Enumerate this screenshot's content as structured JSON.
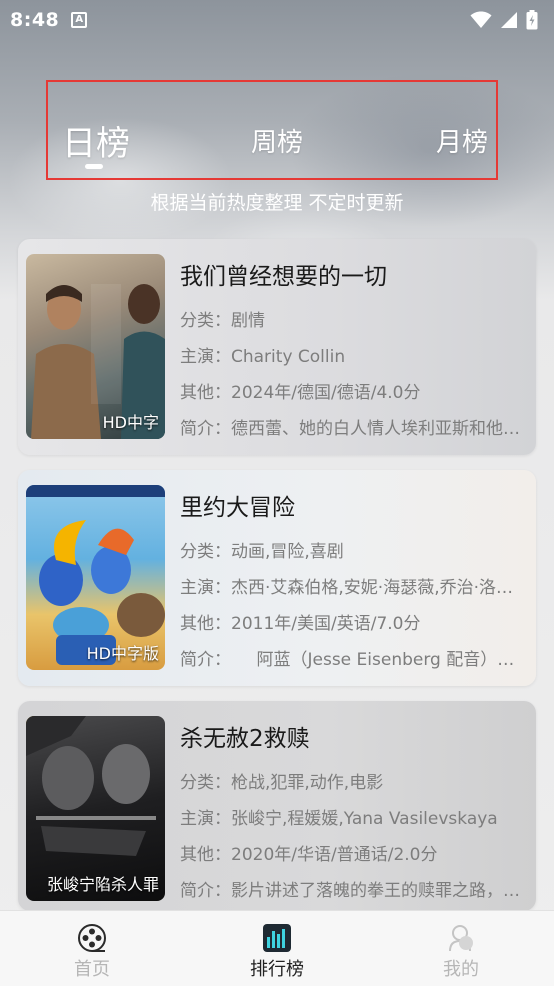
{
  "status_bar": {
    "time": "8:48",
    "app_icon": "A"
  },
  "tabs": [
    {
      "label": "日榜",
      "active": true
    },
    {
      "label": "周榜",
      "active": false
    },
    {
      "label": "月榜",
      "active": false
    }
  ],
  "subtitle": "根据当前热度整理 不定时更新",
  "movies": [
    {
      "title": "我们曾经想要的一切",
      "badge": "HD中字",
      "category": "分类：剧情",
      "cast": "主演：Charity Collin",
      "other": "其他：2024年/德国/德语/4.0分",
      "intro": "简介：德西蕾、她的白人情人埃利亚斯和他们的朋友"
    },
    {
      "title": "里约大冒险",
      "badge": "HD中字版",
      "category": "分类：动画,冒险,喜剧",
      "cast": "主演：杰西·艾森伯格,安妮·海瑟薇,乔治·洛佩兹",
      "other": "其他：2011年/美国/英语/7.0分",
      "intro": "简介：　　阿蓝（Jesse Eisenberg 配音）是一只"
    },
    {
      "title": "杀无赦2救赎",
      "badge": "张峻宁陷杀人罪",
      "category": "分类：枪战,犯罪,动作,电影",
      "cast": "主演：张峻宁,程媛媛,Yana Vasilevskaya",
      "other": "其他：2020年/华语/普通话/2.0分",
      "intro": "简介：影片讲述了落魄的拳王的赎罪之路，为了"
    }
  ],
  "bottom_nav": [
    {
      "label": "首页",
      "icon": "film-reel-icon",
      "active": false
    },
    {
      "label": "排行榜",
      "icon": "chart-icon",
      "active": true
    },
    {
      "label": "我的",
      "icon": "user-icon",
      "active": false
    }
  ],
  "colors": {
    "highlight_border": "#e53935",
    "active_nav": "#222222",
    "inactive_nav": "#b6b6b6"
  }
}
